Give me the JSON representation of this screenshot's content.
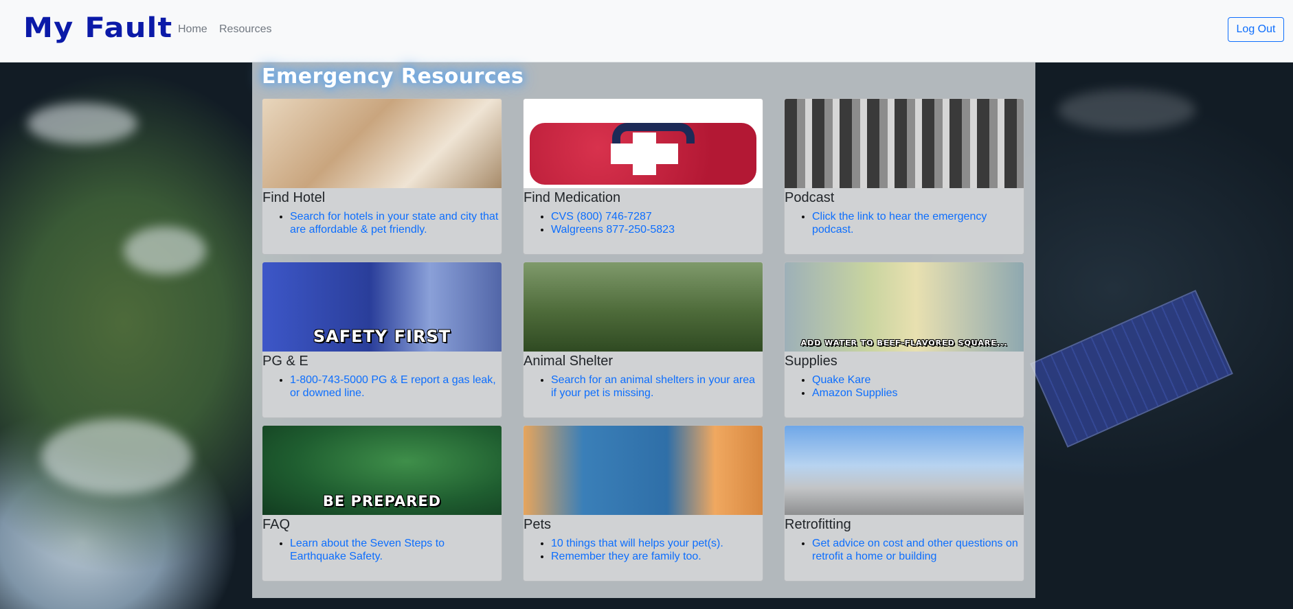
{
  "navbar": {
    "brand": "My Fault",
    "links": [
      "Home",
      "Resources"
    ],
    "logout_label": "Log Out"
  },
  "page": {
    "title": "Emergency Resources"
  },
  "cards": [
    {
      "title": "Find Hotel",
      "image": "hotel-room-image",
      "caption": "",
      "items": [
        "Search for hotels in your state and city that are affordable & pet friendly."
      ]
    },
    {
      "title": "Find Medication",
      "image": "first-aid-kit-image",
      "caption": "",
      "items": [
        "CVS (800) 746-7287",
        "Walgreens 877-250-5823"
      ]
    },
    {
      "title": "Podcast",
      "image": "cartoon-radio-image",
      "caption": "",
      "items": [
        "Click the link to hear the emergency podcast."
      ]
    },
    {
      "title": "PG & E",
      "image": "safety-first-image",
      "caption": "SAFETY FIRST",
      "items": [
        "1-800-743-5000 PG & E report a gas leak, or downed line."
      ]
    },
    {
      "title": "Animal Shelter",
      "image": "dogs-image",
      "caption": "",
      "items": [
        "Search for an animal shelters in your area if your pet is missing."
      ]
    },
    {
      "title": "Supplies",
      "image": "cartoon-supplies-image",
      "caption": "ADD WATER TO BEEF-FLAVORED SQUARE...",
      "items": [
        "Quake Kare",
        "Amazon Supplies"
      ]
    },
    {
      "title": "FAQ",
      "image": "be-prepared-image",
      "caption": "BE PREPARED",
      "items": [
        "Learn about the Seven Steps to Earthquake Safety."
      ]
    },
    {
      "title": "Pets",
      "image": "pets-image",
      "caption": "",
      "items": [
        "10 things that will helps your pet(s).",
        "Remember they are family too."
      ]
    },
    {
      "title": "Retrofitting",
      "image": "construction-site-image",
      "caption": "",
      "items": [
        "Get advice on cost and other questions on retrofit a home or building"
      ]
    }
  ],
  "colors": {
    "brand": "#0b1aa8",
    "link": "#0d6efd",
    "navbar_bg": "#f8f9fa"
  }
}
